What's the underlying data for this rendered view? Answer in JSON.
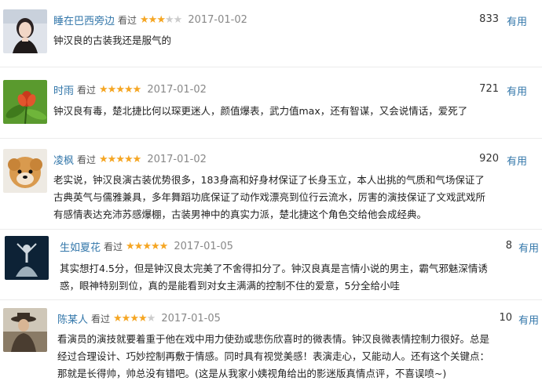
{
  "reviews": [
    {
      "user": "睡在巴西旁边",
      "watched": "看过",
      "rating": 3,
      "stars": "★★★★★",
      "date": "2017-01-02",
      "votes": "833",
      "useful": "有用",
      "avatar": "woman-portrait-avatar",
      "lines": [
        "钟汉良的古装我还是服气的"
      ]
    },
    {
      "user": "时雨",
      "watched": "看过",
      "rating": 5,
      "stars": "★★★★★",
      "date": "2017-01-02",
      "votes": "721",
      "useful": "有用",
      "avatar": "flower-avatar",
      "lines": [
        "钟汉良有毒，楚北捷比何以琛更迷人，颜值爆表，武力值max，还有智谋，又会说情话，爱死了"
      ]
    },
    {
      "user": "凌枫",
      "watched": "看过",
      "rating": 5,
      "stars": "★★★★★",
      "date": "2017-01-02",
      "votes": "920",
      "useful": "有用",
      "avatar": "puppy-avatar",
      "lines": [
        "老实说，钟汉良演古装优势很多，183身高和好身材保证了长身玉立，本人出挑的气质和气场保证了",
        "古典英气与儒雅兼具，多年舞蹈功底保证了动作戏漂亮到位行云流水，厉害的演技保证了文戏武戏所",
        "有感情表达充沛苏感爆棚，古装男神中的真实力派，楚北捷这个角色交给他会成经典。"
      ]
    },
    {
      "user": "生如夏花",
      "watched": "看过",
      "rating": 5,
      "stars": "★★★★★",
      "date": "2017-01-05",
      "votes": "8",
      "useful": "有用",
      "avatar": "dancer-avatar",
      "lines": [
        "其实想打4.5分，但是钟汉良太完美了不舍得扣分了。钟汉良真是言情小说的男主，霸气邪魅深情诱",
        "惑，眼神特别到位，真的是能看到对女主满满的控制不住的爱意，5分全给小哇"
      ]
    },
    {
      "user": "陈某人",
      "watched": "看过",
      "rating": 4,
      "stars": "★★★★★",
      "date": "2017-01-05",
      "votes": "10",
      "useful": "有用",
      "avatar": "man-in-hat-avatar",
      "lines": [
        "看演员的演技就要着重于他在戏中用力使劲或悲伤欣喜时的微表情。钟汉良微表情控制力很好。总是",
        "经过合理设计、巧妙控制再敷于情感。同时具有视觉美感！表演走心，又能动人。还有这个关键点：",
        "那就是长得帅，帅总没有错吧。(这是从我家小姨视角给出的影迷版真情点评，不喜误喷~)"
      ]
    }
  ]
}
